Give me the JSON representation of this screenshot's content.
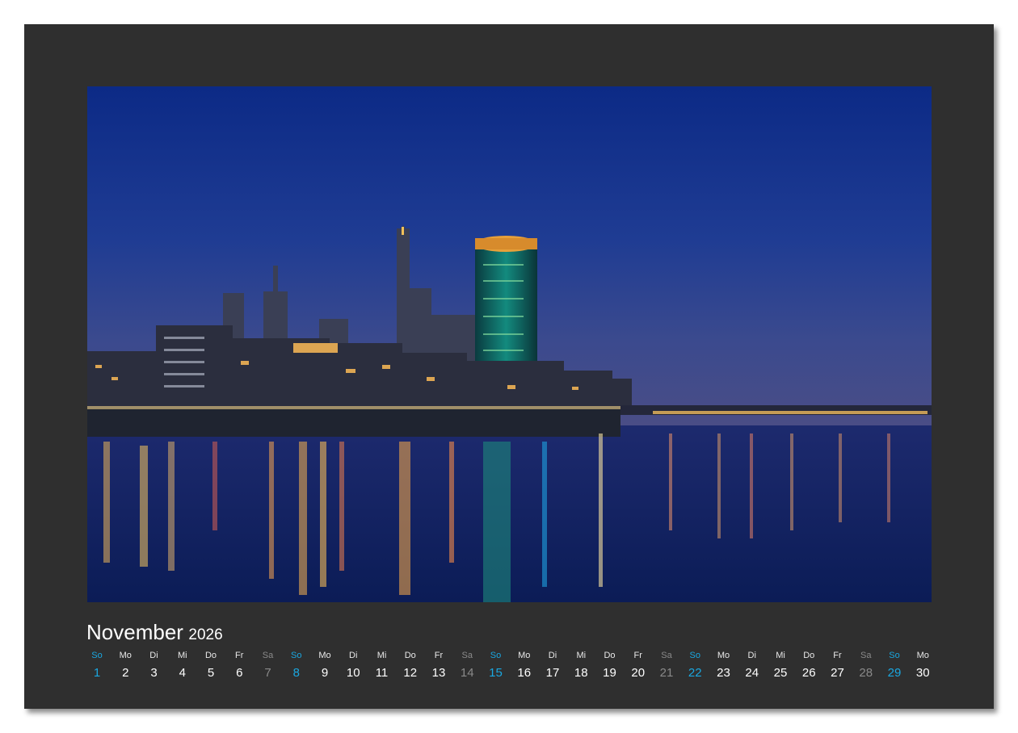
{
  "calendar": {
    "month": "November",
    "year": "2026",
    "days": [
      {
        "name": "So",
        "num": "1",
        "type": "sun"
      },
      {
        "name": "Mo",
        "num": "2",
        "type": "weekday"
      },
      {
        "name": "Di",
        "num": "3",
        "type": "weekday"
      },
      {
        "name": "Mi",
        "num": "4",
        "type": "weekday"
      },
      {
        "name": "Do",
        "num": "5",
        "type": "weekday"
      },
      {
        "name": "Fr",
        "num": "6",
        "type": "weekday"
      },
      {
        "name": "Sa",
        "num": "7",
        "type": "sat"
      },
      {
        "name": "So",
        "num": "8",
        "type": "sun"
      },
      {
        "name": "Mo",
        "num": "9",
        "type": "weekday"
      },
      {
        "name": "Di",
        "num": "10",
        "type": "weekday"
      },
      {
        "name": "Mi",
        "num": "11",
        "type": "weekday"
      },
      {
        "name": "Do",
        "num": "12",
        "type": "weekday"
      },
      {
        "name": "Fr",
        "num": "13",
        "type": "weekday"
      },
      {
        "name": "Sa",
        "num": "14",
        "type": "sat"
      },
      {
        "name": "So",
        "num": "15",
        "type": "sun"
      },
      {
        "name": "Mo",
        "num": "16",
        "type": "weekday"
      },
      {
        "name": "Di",
        "num": "17",
        "type": "weekday"
      },
      {
        "name": "Mi",
        "num": "18",
        "type": "weekday"
      },
      {
        "name": "Do",
        "num": "19",
        "type": "weekday"
      },
      {
        "name": "Fr",
        "num": "20",
        "type": "weekday"
      },
      {
        "name": "Sa",
        "num": "21",
        "type": "sat"
      },
      {
        "name": "So",
        "num": "22",
        "type": "sun"
      },
      {
        "name": "Mo",
        "num": "23",
        "type": "weekday"
      },
      {
        "name": "Di",
        "num": "24",
        "type": "weekday"
      },
      {
        "name": "Mi",
        "num": "25",
        "type": "weekday"
      },
      {
        "name": "Do",
        "num": "26",
        "type": "weekday"
      },
      {
        "name": "Fr",
        "num": "27",
        "type": "weekday"
      },
      {
        "name": "Sa",
        "num": "28",
        "type": "sat"
      },
      {
        "name": "So",
        "num": "29",
        "type": "sun"
      },
      {
        "name": "Mo",
        "num": "30",
        "type": "weekday"
      }
    ]
  },
  "colors": {
    "sheet_background": "#2f2f2f",
    "sunday": "#1aa7e0",
    "saturday": "#8a8a8a",
    "weekday": "#ffffff"
  },
  "photo": {
    "subject": "night-city-skyline-river-photo"
  }
}
